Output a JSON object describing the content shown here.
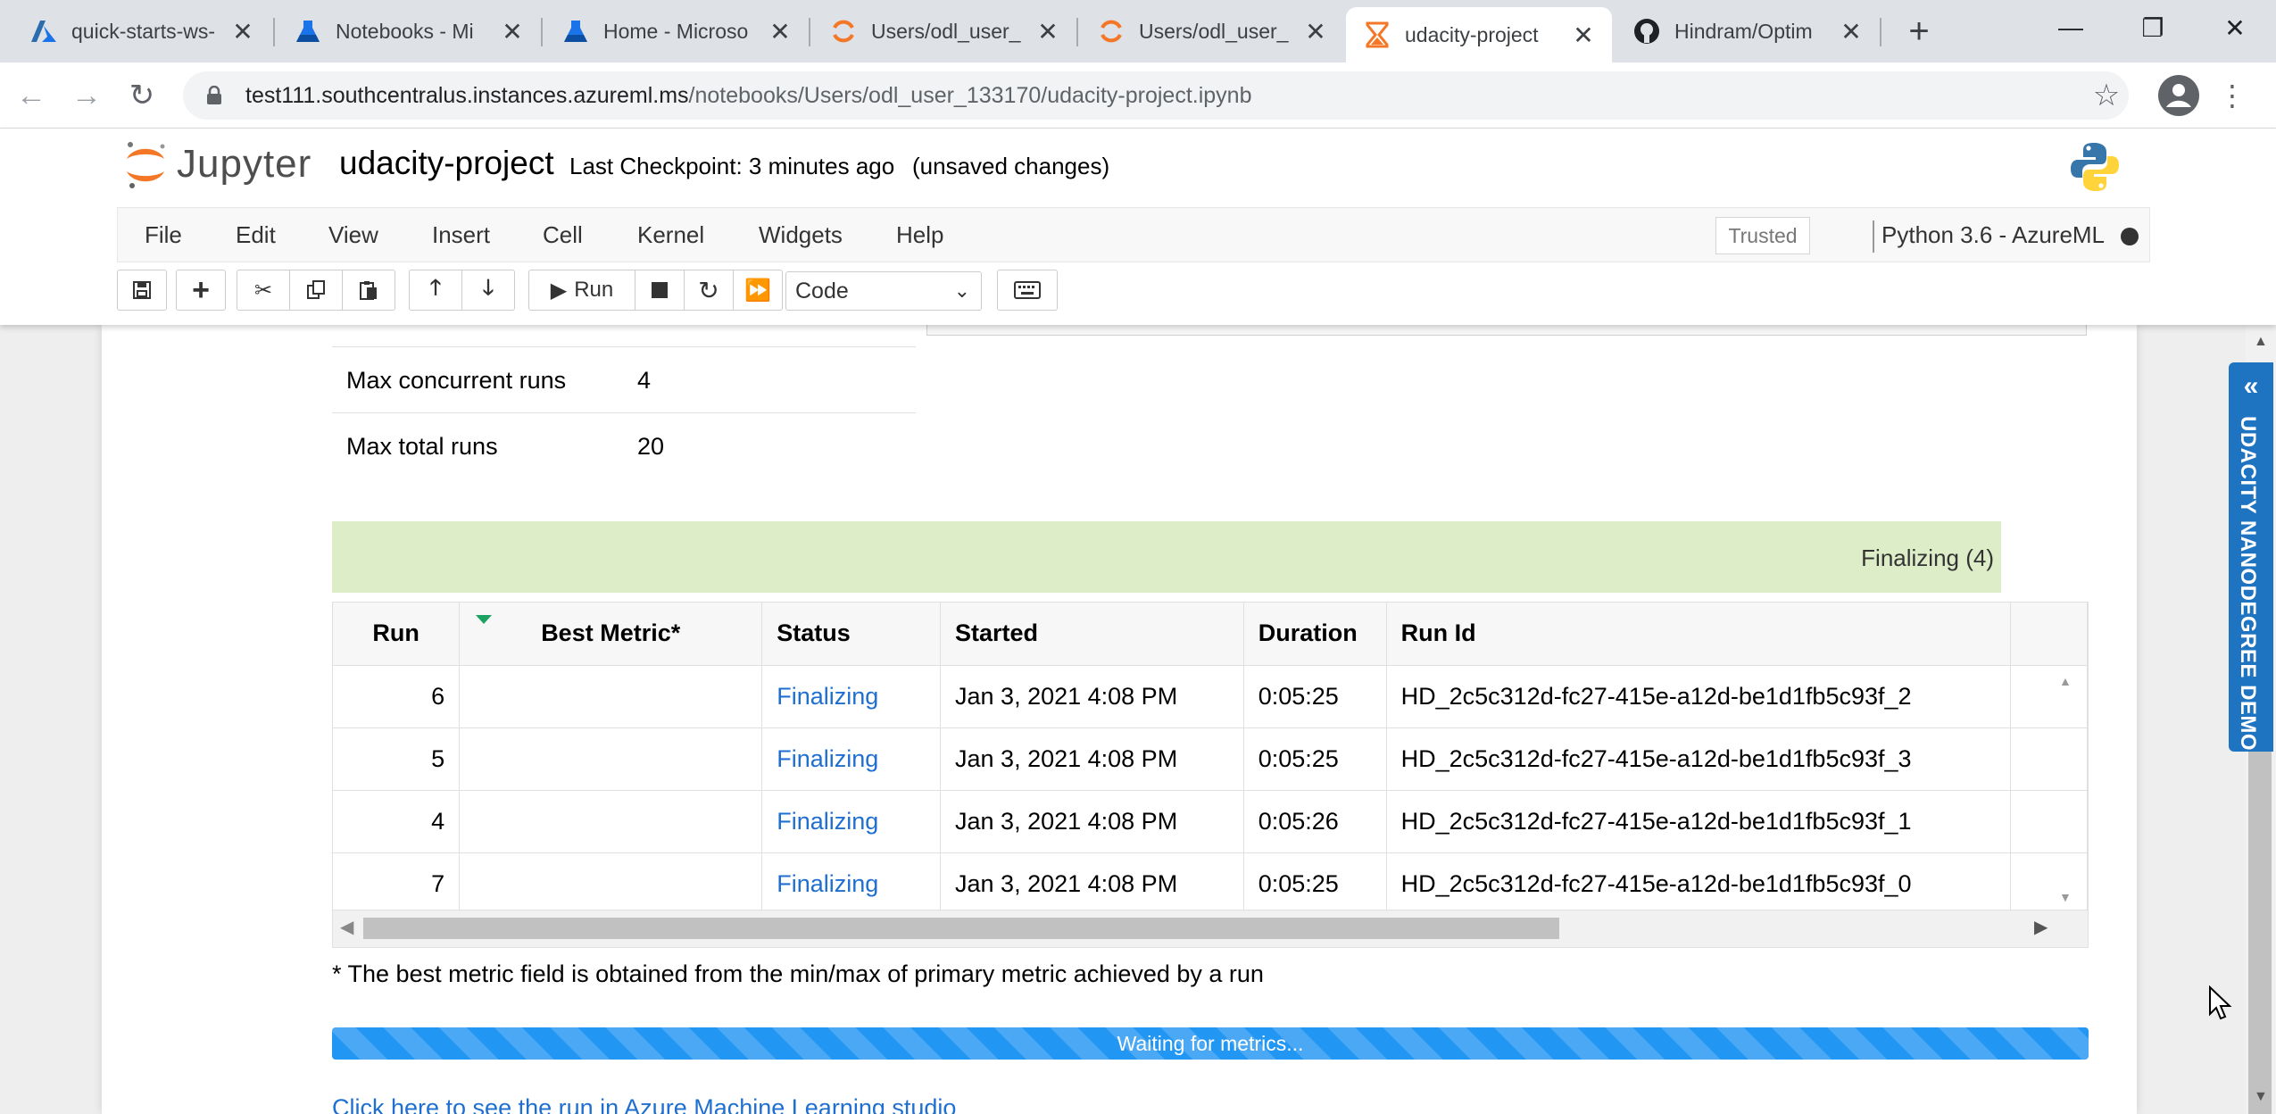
{
  "browser": {
    "tabs": [
      {
        "label": "quick-starts-ws-",
        "icon": "azure-icon"
      },
      {
        "label": "Notebooks - Mi",
        "icon": "azure-ml-icon"
      },
      {
        "label": "Home - Microso",
        "icon": "azure-ml-icon"
      },
      {
        "label": "Users/odl_user_",
        "icon": "jupyter-icon"
      },
      {
        "label": "Users/odl_user_",
        "icon": "jupyter-icon"
      },
      {
        "label": "udacity-project",
        "icon": "hourglass-icon"
      },
      {
        "label": "Hindram/Optim",
        "icon": "github-icon"
      }
    ],
    "url_host": "test111.southcentralus.instances.azureml.ms",
    "url_path": "/notebooks/Users/odl_user_133170/udacity-project.ipynb"
  },
  "jupyter": {
    "logo_text": "Jupyter",
    "notebook_title": "udacity-project",
    "checkpoint": "Last Checkpoint: 3 minutes ago",
    "save_status": "(unsaved changes)",
    "menu": [
      "File",
      "Edit",
      "View",
      "Insert",
      "Cell",
      "Kernel",
      "Widgets",
      "Help"
    ],
    "trusted": "Trusted",
    "kernel": "Python 3.6 - AzureML",
    "run_label": "Run",
    "cell_type": "Code"
  },
  "output": {
    "config": [
      {
        "key": "Max concurrent runs",
        "value": "4"
      },
      {
        "key": "Max total runs",
        "value": "20"
      }
    ],
    "status_summary": "Finalizing (4)",
    "table": {
      "headers": [
        "Run",
        "Best Metric*",
        "Status",
        "Started",
        "Duration",
        "Run Id"
      ],
      "rows": [
        {
          "run": "6",
          "best": "",
          "status": "Finalizing",
          "started": "Jan 3, 2021 4:08 PM",
          "duration": "0:05:25",
          "run_id": "HD_2c5c312d-fc27-415e-a12d-be1d1fb5c93f_2"
        },
        {
          "run": "5",
          "best": "",
          "status": "Finalizing",
          "started": "Jan 3, 2021 4:08 PM",
          "duration": "0:05:25",
          "run_id": "HD_2c5c312d-fc27-415e-a12d-be1d1fb5c93f_3"
        },
        {
          "run": "4",
          "best": "",
          "status": "Finalizing",
          "started": "Jan 3, 2021 4:08 PM",
          "duration": "0:05:26",
          "run_id": "HD_2c5c312d-fc27-415e-a12d-be1d1fb5c93f_1"
        },
        {
          "run": "7",
          "best": "",
          "status": "Finalizing",
          "started": "Jan 3, 2021 4:08 PM",
          "duration": "0:05:25",
          "run_id": "HD_2c5c312d-fc27-415e-a12d-be1d1fb5c93f_0"
        }
      ]
    },
    "footnote": "* The best metric field is obtained from the min/max of primary metric achieved by a run",
    "progress_text": "Waiting for metrics...",
    "studio_link": "Click here to see the run in Azure Machine Learning studio"
  },
  "side_banner": "UDACITY NANODEGREE DEMO",
  "colors": {
    "status_bar": "#dcedc8",
    "link": "#1f6fd1",
    "progress": "#2196f3",
    "banner": "#1f74c2"
  }
}
